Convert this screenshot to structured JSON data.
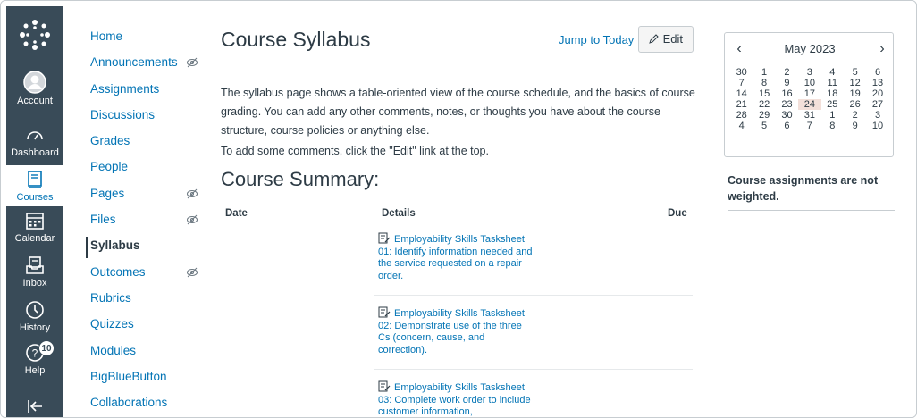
{
  "global_nav": {
    "logo_icon": "canvas-logo-icon",
    "items": [
      {
        "label": "Account",
        "icon": "account-icon"
      },
      {
        "label": "Dashboard",
        "icon": "dashboard-icon"
      },
      {
        "label": "Courses",
        "icon": "courses-icon"
      },
      {
        "label": "Calendar",
        "icon": "calendar-icon"
      },
      {
        "label": "Inbox",
        "icon": "inbox-icon"
      },
      {
        "label": "History",
        "icon": "history-icon"
      },
      {
        "label": "Help",
        "icon": "help-icon",
        "badge": "10"
      }
    ],
    "collapse_icon": "collapse-icon"
  },
  "course_nav": {
    "items": [
      {
        "label": "Home"
      },
      {
        "label": "Announcements",
        "hidden": true
      },
      {
        "label": "Assignments"
      },
      {
        "label": "Discussions"
      },
      {
        "label": "Grades"
      },
      {
        "label": "People"
      },
      {
        "label": "Pages",
        "hidden": true
      },
      {
        "label": "Files",
        "hidden": true
      },
      {
        "label": "Syllabus"
      },
      {
        "label": "Outcomes",
        "hidden": true
      },
      {
        "label": "Rubrics"
      },
      {
        "label": "Quizzes"
      },
      {
        "label": "Modules"
      },
      {
        "label": "BigBlueButton"
      },
      {
        "label": "Collaborations"
      }
    ]
  },
  "main": {
    "title": "Course Syllabus",
    "jump_to_today": "Jump to Today",
    "edit_label": "Edit",
    "para1": "The syllabus page shows a table-oriented view of the course schedule, and the basics of course grading. You can add any other comments, notes, or thoughts you have about the course structure, course policies or anything else.",
    "para2": "To add some comments, click the \"Edit\" link at the top.",
    "summary_heading": "Course Summary:",
    "table": {
      "headers": {
        "date": "Date",
        "details": "Details",
        "due": "Due"
      },
      "rows": [
        {
          "text": "Employability Skills Tasksheet 01: Identify information needed and the service requested on a repair order."
        },
        {
          "text": "Employability Skills Tasksheet 02: Demonstrate use of the three Cs (concern, cause, and correction)."
        },
        {
          "text": "Employability Skills Tasksheet 03: Complete work order to include customer information,"
        }
      ]
    }
  },
  "calendar": {
    "month": "May 2023",
    "weeks": [
      [
        "30",
        "1",
        "2",
        "3",
        "4",
        "5",
        "6"
      ],
      [
        "7",
        "8",
        "9",
        "10",
        "11",
        "12",
        "13"
      ],
      [
        "14",
        "15",
        "16",
        "17",
        "18",
        "19",
        "20"
      ],
      [
        "21",
        "22",
        "23",
        "24",
        "25",
        "26",
        "27"
      ],
      [
        "28",
        "29",
        "30",
        "31",
        "1",
        "2",
        "3"
      ],
      [
        "4",
        "5",
        "6",
        "7",
        "8",
        "9",
        "10"
      ]
    ],
    "today": "24"
  },
  "weighting_note": "Course assignments are not weighted.",
  "colors": {
    "nav_bg": "#394b58",
    "link": "#0374b5",
    "text": "#2d3b45",
    "today_bg": "#f3e0da"
  }
}
